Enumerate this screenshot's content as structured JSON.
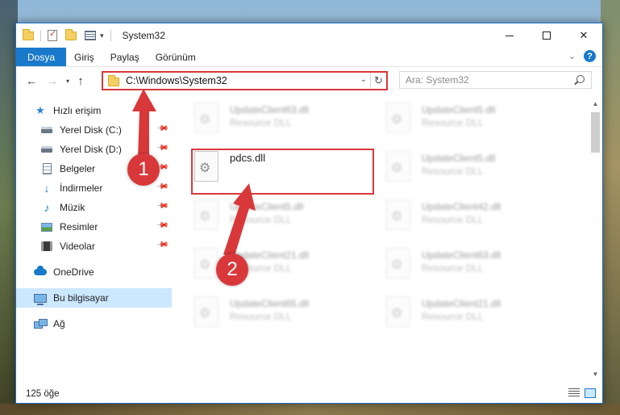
{
  "window": {
    "title": "System32",
    "controls": {
      "minimize": "",
      "maximize": "",
      "close": "✕"
    }
  },
  "ribbon": {
    "tabs": [
      "Dosya",
      "Giriş",
      "Paylaş",
      "Görünüm"
    ],
    "collapse_icon": "⌄",
    "help_icon": "?"
  },
  "nav": {
    "back": "←",
    "forward": "→",
    "recent": "▾",
    "up": "↑",
    "address": "C:\\Windows\\System32",
    "address_drop": "⌄",
    "refresh": "↻",
    "search_placeholder": "Ara: System32"
  },
  "sidebar": {
    "items": [
      {
        "label": "Hızlı erişim",
        "icon": "star-icon",
        "pinned": false
      },
      {
        "label": "Yerel Disk (C:)",
        "icon": "disk-icon",
        "pinned": true
      },
      {
        "label": "Yerel Disk (D:)",
        "icon": "disk-icon",
        "pinned": true
      },
      {
        "label": "Belgeler",
        "icon": "documents-icon",
        "pinned": true
      },
      {
        "label": "İndirmeler",
        "icon": "downloads-icon",
        "pinned": true
      },
      {
        "label": "Müzik",
        "icon": "music-icon",
        "pinned": true
      },
      {
        "label": "Resimler",
        "icon": "pictures-icon",
        "pinned": true
      },
      {
        "label": "Videolar",
        "icon": "videos-icon",
        "pinned": true
      },
      {
        "label": "OneDrive",
        "icon": "onedrive-icon",
        "pinned": false
      },
      {
        "label": "Bu bilgisayar",
        "icon": "this-pc-icon",
        "pinned": false,
        "selected": true
      },
      {
        "label": "Ağ",
        "icon": "network-icon",
        "pinned": false
      }
    ],
    "pin_glyph": "📌"
  },
  "files": {
    "focused": {
      "name": "pdcs.dll"
    },
    "left_column": [
      {
        "name": "UpdateClient63.dll",
        "type": "Resource DLL"
      },
      {
        "name": "pdcs.dll",
        "type": ""
      },
      {
        "name": "UpdateClient5.dll",
        "type": "Resource DLL"
      },
      {
        "name": "UpdateClient21.dll",
        "type": "Resource DLL"
      },
      {
        "name": "UpdateClient65.dll",
        "type": "Resource DLL"
      }
    ],
    "right_column": [
      {
        "name": "UpdateClient5.dll",
        "type": "Resource DLL"
      },
      {
        "name": "UpdateClient5.dll",
        "type": "Resource DLL"
      },
      {
        "name": "UpdateClient42.dll",
        "type": "Resource DLL"
      },
      {
        "name": "UpdateClient63.dll",
        "type": "Resource DLL"
      },
      {
        "name": "UpdateClient21.dll",
        "type": "Resource DLL"
      }
    ]
  },
  "status": {
    "count": "125 öğe"
  },
  "annotations": {
    "marker1": "1",
    "marker2": "2",
    "accent": "#d9383a"
  },
  "colors": {
    "accent": "#1979ca",
    "selection": "#cce8ff",
    "highlight": "#d9383a"
  }
}
